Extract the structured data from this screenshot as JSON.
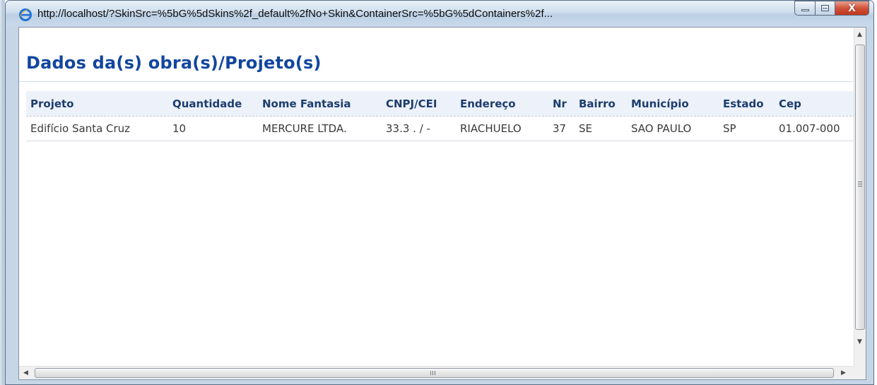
{
  "window": {
    "title": "http://localhost/?SkinSrc=%5bG%5dSkins%2f_default%2fNo+Skin&ContainerSrc=%5bG%5dContainers%2f...",
    "controls": {
      "minimize_icon": "minimize-icon",
      "maximize_icon": "maximize-icon",
      "close_glyph": "X"
    }
  },
  "page": {
    "title": "Dados da(s) obra(s)/Projeto(s)"
  },
  "table": {
    "columns": [
      "Projeto",
      "Quantidade",
      "Nome Fantasia",
      "CNPJ/CEI",
      "Endereço",
      "Nr",
      "Bairro",
      "Município",
      "Estado",
      "Cep"
    ],
    "rows": [
      [
        "Edifício Santa Cruz",
        "10",
        "MERCURE LTDA.",
        "33.3 . / -",
        "RIACHUELO",
        "37",
        "SE",
        "SAO PAULO",
        "SP",
        "01.007-000"
      ]
    ]
  },
  "scrollbars": {
    "vertical": {
      "up_icon": "arrow-up-icon",
      "down_icon": "arrow-down-icon"
    },
    "horizontal": {
      "left_icon": "arrow-left-icon",
      "right_icon": "arrow-right-icon"
    }
  },
  "colors": {
    "title": "#11469e",
    "header_bg": "#edf2fa",
    "header_text": "#1c3d6d",
    "cell_text": "#3a3a3a",
    "close_button": "#c2361c"
  }
}
